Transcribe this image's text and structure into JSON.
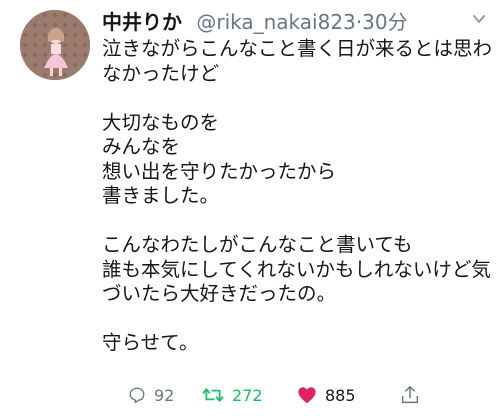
{
  "tweet": {
    "author": {
      "display_name": "中井りか",
      "handle": "@rika_nakai823",
      "separator": "·",
      "time": "30分",
      "avatar_icon": "avatar-photo"
    },
    "menu_icon": "chevron-down-icon",
    "lines": [
      "泣きながらこんなこと書く日が来るとは思わ",
      "なかったけど",
      "",
      "大切なものを",
      "みんなを",
      "想い出を守りたかったから",
      "書きました。",
      "",
      "こんなわたしがこんなこと書いても",
      "誰も本気にしてくれないかもしれないけど気",
      "づいたら大好きだったの。",
      "",
      "守らせて。"
    ],
    "actions": {
      "reply": {
        "icon": "reply-icon",
        "count": "92"
      },
      "retweet": {
        "icon": "retweet-icon",
        "count": "272",
        "color": "#17bf63"
      },
      "like": {
        "icon": "heart-icon",
        "count": "885",
        "color": "#e0245e"
      },
      "share": {
        "icon": "share-icon"
      }
    }
  }
}
